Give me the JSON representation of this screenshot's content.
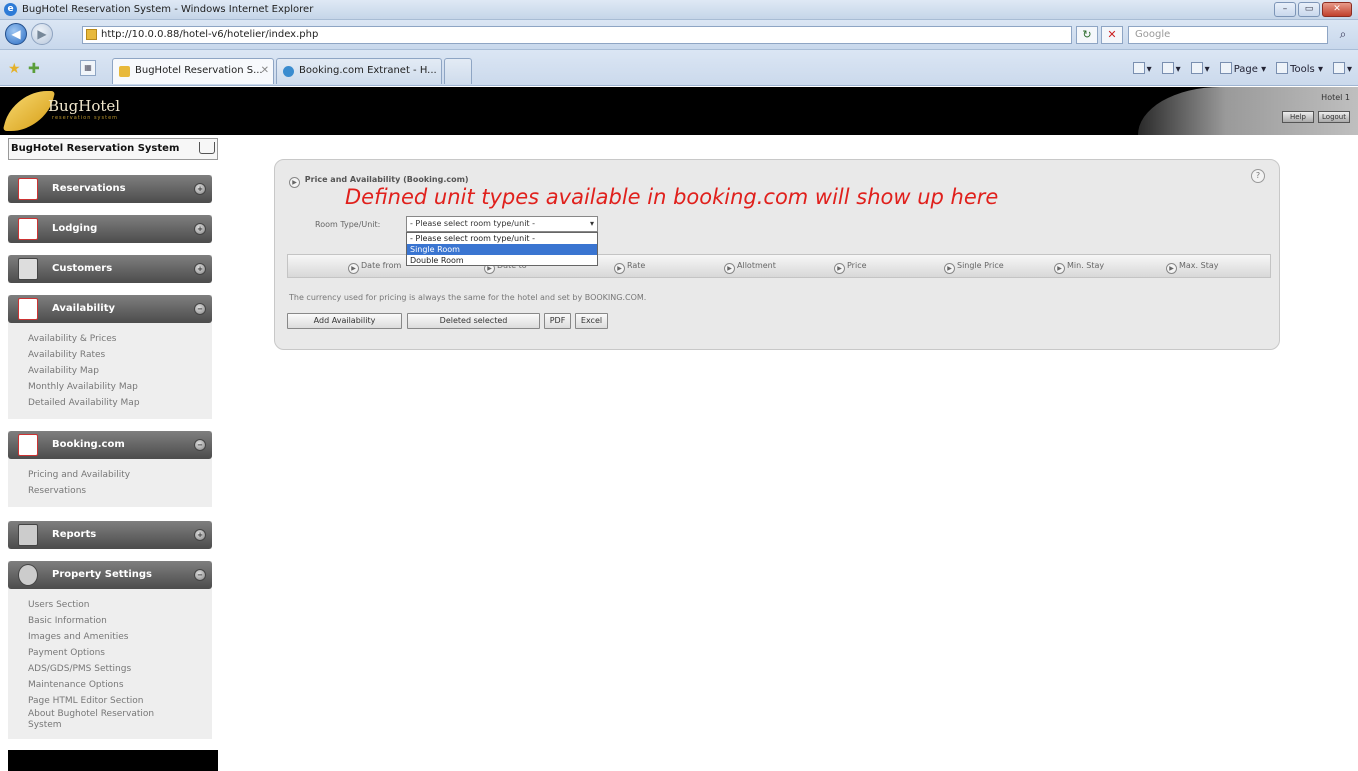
{
  "browser": {
    "window_title": "BugHotel Reservation System - Windows Internet Explorer",
    "url": "http://10.0.0.88/hotel-v6/hotelier/index.php",
    "search_placeholder": "Google",
    "tabs": [
      {
        "label": "BugHotel Reservation S..."
      },
      {
        "label": "Booking.com Extranet - H..."
      }
    ],
    "command_bar": [
      "Page ▾",
      "Tools ▾"
    ]
  },
  "header": {
    "logo_text": "BugHotel",
    "logo_subtitle": "reservation system",
    "hotel_label": "Hotel 1",
    "buttons": [
      "Help",
      "Logout"
    ]
  },
  "sidebar": {
    "system_title": "BugHotel Reservation System",
    "sections": [
      {
        "label": "Reservations",
        "links": []
      },
      {
        "label": "Lodging",
        "links": []
      },
      {
        "label": "Customers",
        "links": []
      },
      {
        "label": "Availability",
        "links": [
          "Availability & Prices",
          "Availability Rates",
          "Availability Map",
          "Monthly Availability Map",
          "Detailed Availability Map"
        ]
      },
      {
        "label": "Booking.com",
        "links": [
          "Pricing and Availability",
          "Reservations"
        ]
      },
      {
        "label": "Reports",
        "links": []
      },
      {
        "label": "Property Settings",
        "links": [
          "Users Section",
          "Basic Information",
          "Images and Amenities",
          "Payment Options",
          "ADS/GDS/PMS Settings",
          "Maintenance Options",
          "Page HTML Editor Section",
          "About Bughotel Reservation System"
        ]
      }
    ]
  },
  "panel": {
    "title": "Price and Availability (Booking.com)",
    "annotation": "Defined unit types available in booking.com will show up here",
    "room_type_label": "Room Type/Unit:",
    "room_type_selected": "- Please select room type/unit -",
    "room_type_options": [
      "- Please select room type/unit -",
      "Single Room",
      "Double Room"
    ],
    "highlighted_option": 1,
    "columns": [
      "Date from",
      "Date to",
      "Rate",
      "Allotment",
      "Price",
      "Single Price",
      "Min. Stay",
      "Max. Stay"
    ],
    "currency_note": "The currency used for pricing is always the same for the hotel and set by BOOKING.COM.",
    "buttons": {
      "add": "Add Availability",
      "delete": "Deleted selected",
      "pdf": "PDF",
      "excel": "Excel"
    }
  },
  "colors": {
    "annotation": "#e0201c",
    "selection": "#3a75d1",
    "header_bg": "#000000"
  }
}
